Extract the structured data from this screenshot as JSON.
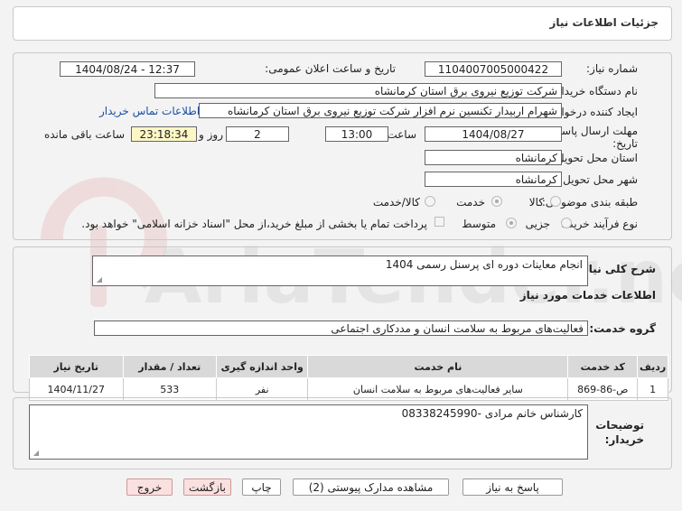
{
  "header": {
    "title": "جزئیات اطلاعات نیاز"
  },
  "form": {
    "need_number_label": "شماره نیاز:",
    "need_number": "1104007005000422",
    "announce_label": "تاریخ و ساعت اعلان عمومی:",
    "announce_value": "1404/08/24 - 12:37",
    "buyer_org_label": "نام دستگاه خریدار:",
    "buyer_org": "شرکت توزیع نیروی برق استان کرمانشاه",
    "creator_label": "ایجاد کننده درخواست:",
    "creator": "شهرام اربیدار تکنسین نرم افزار شرکت توزیع نیروی برق استان کرمانشاه",
    "contact_link": "اطلاعات تماس خریدار",
    "deadline_label_1": "مهلت ارسال پاسخ: تا",
    "deadline_label_2": "تاریخ:",
    "deadline_date": "1404/08/27",
    "time_label": "ساعت",
    "deadline_time": "13:00",
    "days_value": "2",
    "days_label": "روز و",
    "remaining_time": "23:18:34",
    "remaining_label": "ساعت باقی مانده",
    "province_label": "استان محل تحویل:",
    "province": "کرمانشاه",
    "city_label": "شهر محل تحویل:",
    "city": "کرمانشاه",
    "category_label": "طبقه بندی موضوعی:",
    "category_options": [
      "کالا",
      "خدمت",
      "کالا/خدمت"
    ],
    "category_selected": "خدمت",
    "process_label": "نوع فرآیند خرید :",
    "process_options": [
      "جزیی",
      "متوسط"
    ],
    "process_selected": "متوسط",
    "payment_note": "پرداخت تمام یا بخشی از مبلغ خرید،از محل \"اسناد خزانه اسلامی\" خواهد بود."
  },
  "summary": {
    "label": "شرح کلی نیاز:",
    "value": "انجام معاینات دوره ای پرسنل رسمی 1404"
  },
  "services": {
    "section_title": "اطلاعات خدمات مورد نیاز",
    "group_label": "گروه خدمت:",
    "group_value": "فعالیت‌های مربوط به سلامت انسان و مددکاری اجتماعی",
    "columns": [
      "ردیف",
      "کد خدمت",
      "نام خدمت",
      "واحد اندازه گیری",
      "تعداد / مقدار",
      "تاریخ نیاز"
    ],
    "rows": [
      [
        "1",
        "ص-86-869",
        "سایر فعالیت‌های مربوط به سلامت انسان",
        "نفر",
        "533",
        "1404/11/27"
      ]
    ]
  },
  "notes": {
    "label_1": "توضیحات",
    "label_2": "خریدار:",
    "value": "کارشناس خانم مرادی -08338245990"
  },
  "buttons": {
    "reply": "پاسخ به نیاز",
    "attachments": "مشاهده مدارک پیوستی (2)",
    "print": "چاپ",
    "back": "بازگشت",
    "exit": "خروج"
  },
  "watermark": {
    "text": "AriaTender.net"
  }
}
